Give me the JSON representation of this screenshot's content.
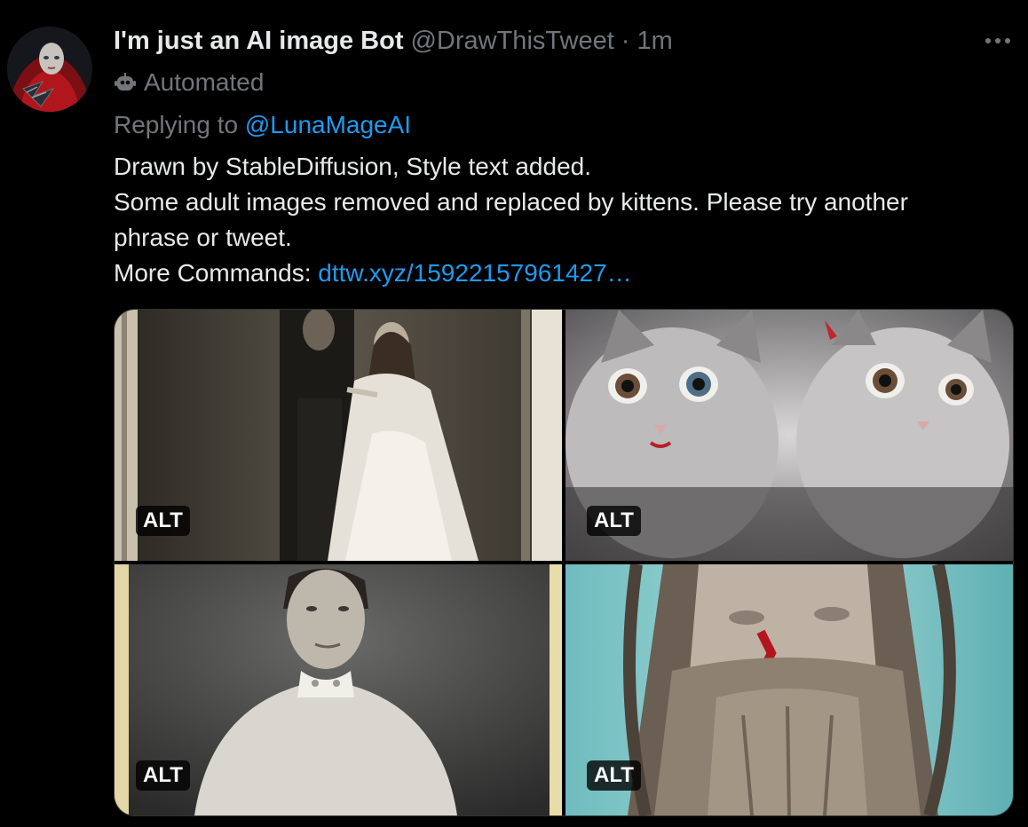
{
  "tweet": {
    "display_name": "I'm just an AI image Bot",
    "handle": "@DrawThisTweet",
    "separator": "·",
    "time": "1m",
    "automated_label": "Automated",
    "replying_prefix": "Replying to",
    "replying_to": "@LunaMageAI",
    "lines": [
      "Drawn by StableDiffusion, Style text added.",
      "Some adult images removed and replaced by kittens. Please try another phrase or tweet."
    ],
    "more_commands_label": "More Commands:",
    "more_commands_link": "dttw.xyz/15922157961427…"
  },
  "media": {
    "alt_badges": [
      "ALT",
      "ALT",
      "ALT",
      "ALT"
    ]
  },
  "colors": {
    "background": "#000000",
    "text": "#e7e9ea",
    "secondary": "#71767b",
    "link": "#1d9bf0"
  },
  "icons": [
    "more-options-icon",
    "robot-icon"
  ]
}
